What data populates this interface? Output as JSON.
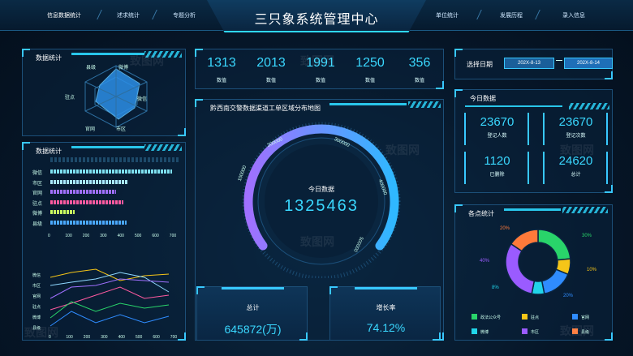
{
  "header": {
    "title": "三只象系统管理中心",
    "nav_left": [
      "信息数据统计",
      "述求统计",
      "专题分析"
    ],
    "nav_right": [
      "单位统计",
      "发展历程",
      "录入信息"
    ]
  },
  "panel_radar": {
    "title": "数据统计",
    "labels": [
      "县级",
      "微博",
      "微信",
      "市区",
      "官网",
      "驻点"
    ]
  },
  "panel_bars": {
    "title": "数据统计",
    "rows": [
      {
        "label": "微信",
        "value": 700,
        "color": "#7ee0f0"
      },
      {
        "label": "市区",
        "value": 450,
        "color": "#a9e8ff"
      },
      {
        "label": "官网",
        "value": 380,
        "color": "#a070ff"
      },
      {
        "label": "驻点",
        "value": 420,
        "color": "#ff5aa0"
      },
      {
        "label": "微博",
        "value": 140,
        "color": "#c8ff60"
      },
      {
        "label": "县级",
        "value": 440,
        "color": "#4aa8ff"
      }
    ],
    "axis": [
      "0",
      "100",
      "200",
      "300",
      "400",
      "500",
      "600",
      "700"
    ]
  },
  "panel_lines": {
    "labels": [
      "微信",
      "市区",
      "官网",
      "驻点",
      "微博",
      "县级"
    ],
    "axis": [
      "0",
      "100",
      "200",
      "300",
      "400",
      "500",
      "600",
      "700"
    ]
  },
  "stats": [
    {
      "value": "1313",
      "label": "数值"
    },
    {
      "value": "2013",
      "label": "数值"
    },
    {
      "value": "1991",
      "label": "数值"
    },
    {
      "value": "1250",
      "label": "数值"
    },
    {
      "value": "356",
      "label": "数值"
    }
  ],
  "map": {
    "title": "黔西南交警数据渠道工单区域分布地图",
    "gauge_title": "今日数据",
    "gauge_value": "1325463",
    "ticks": [
      "100000",
      "200000",
      "300000",
      "400000",
      "500000"
    ]
  },
  "total": {
    "label": "总计",
    "value": "645872(万)"
  },
  "growth": {
    "label": "增长率",
    "value": "74.12%"
  },
  "date": {
    "title": "选择日期",
    "start": "202X-8-13",
    "end": "202X-8-14"
  },
  "today": {
    "title": "今日数据",
    "items": [
      {
        "value": "23670",
        "label": "登记人数"
      },
      {
        "value": "23670",
        "label": "登记次数"
      },
      {
        "value": "1120",
        "label": "已删除"
      },
      {
        "value": "24620",
        "label": "总计"
      }
    ]
  },
  "points": {
    "title": "各点统计",
    "donut": [
      {
        "pct": "30%",
        "value": 30,
        "color": "#29d46a"
      },
      {
        "pct": "10%",
        "value": 10,
        "color": "#f5c518"
      },
      {
        "pct": "20%",
        "value": 20,
        "color": "#2f8cff"
      },
      {
        "pct": "8%",
        "value": 8,
        "color": "#21d4e8"
      },
      {
        "pct": "40%",
        "value": 40,
        "color": "#9a5bff"
      },
      {
        "pct": "20%",
        "value": 20,
        "color": "#ff7a3a"
      }
    ],
    "legend": [
      {
        "label": "政法公众号",
        "color": "#29d46a"
      },
      {
        "label": "驻点",
        "color": "#f5c518"
      },
      {
        "label": "官网",
        "color": "#2f8cff"
      },
      {
        "label": "微博",
        "color": "#21d4e8"
      },
      {
        "label": "市区",
        "color": "#9a5bff"
      },
      {
        "label": "县级",
        "color": "#ff7a3a"
      }
    ]
  },
  "watermark": "致图网"
}
